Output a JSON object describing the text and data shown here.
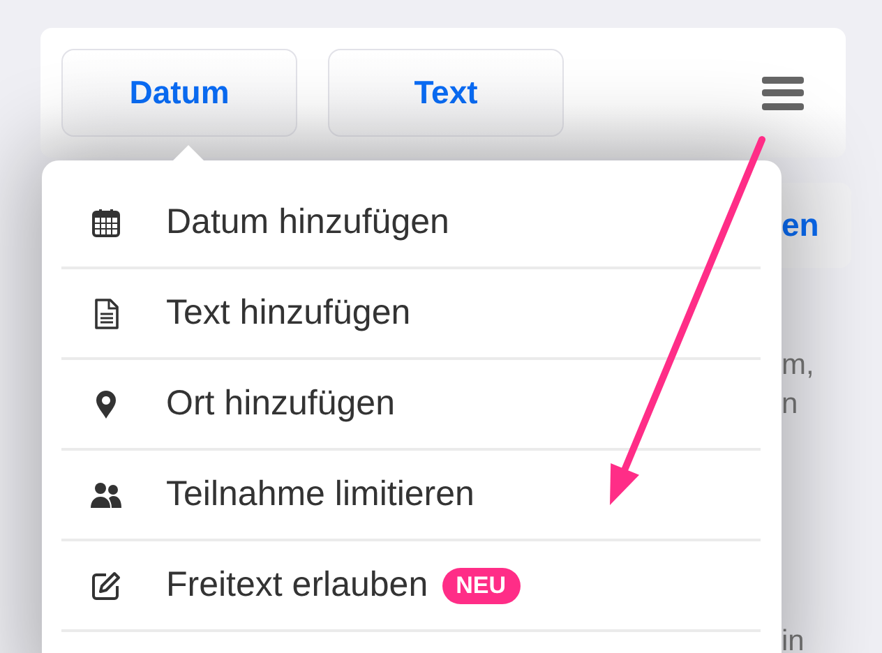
{
  "toolbar": {
    "buttons": [
      {
        "label": "Datum"
      },
      {
        "label": "Text"
      }
    ]
  },
  "menu": {
    "items": [
      {
        "label": "Datum hinzufügen",
        "kind": "calendar"
      },
      {
        "label": "Text hinzufügen",
        "kind": "document"
      },
      {
        "label": "Ort hinzufügen",
        "kind": "pin"
      },
      {
        "label": "Teilnahme limitieren",
        "kind": "people"
      },
      {
        "label": "Freitext erlauben",
        "kind": "edit",
        "badge": "NEU"
      }
    ]
  },
  "background": {
    "button": "en",
    "texts": [
      "m,",
      "n",
      "in"
    ]
  }
}
